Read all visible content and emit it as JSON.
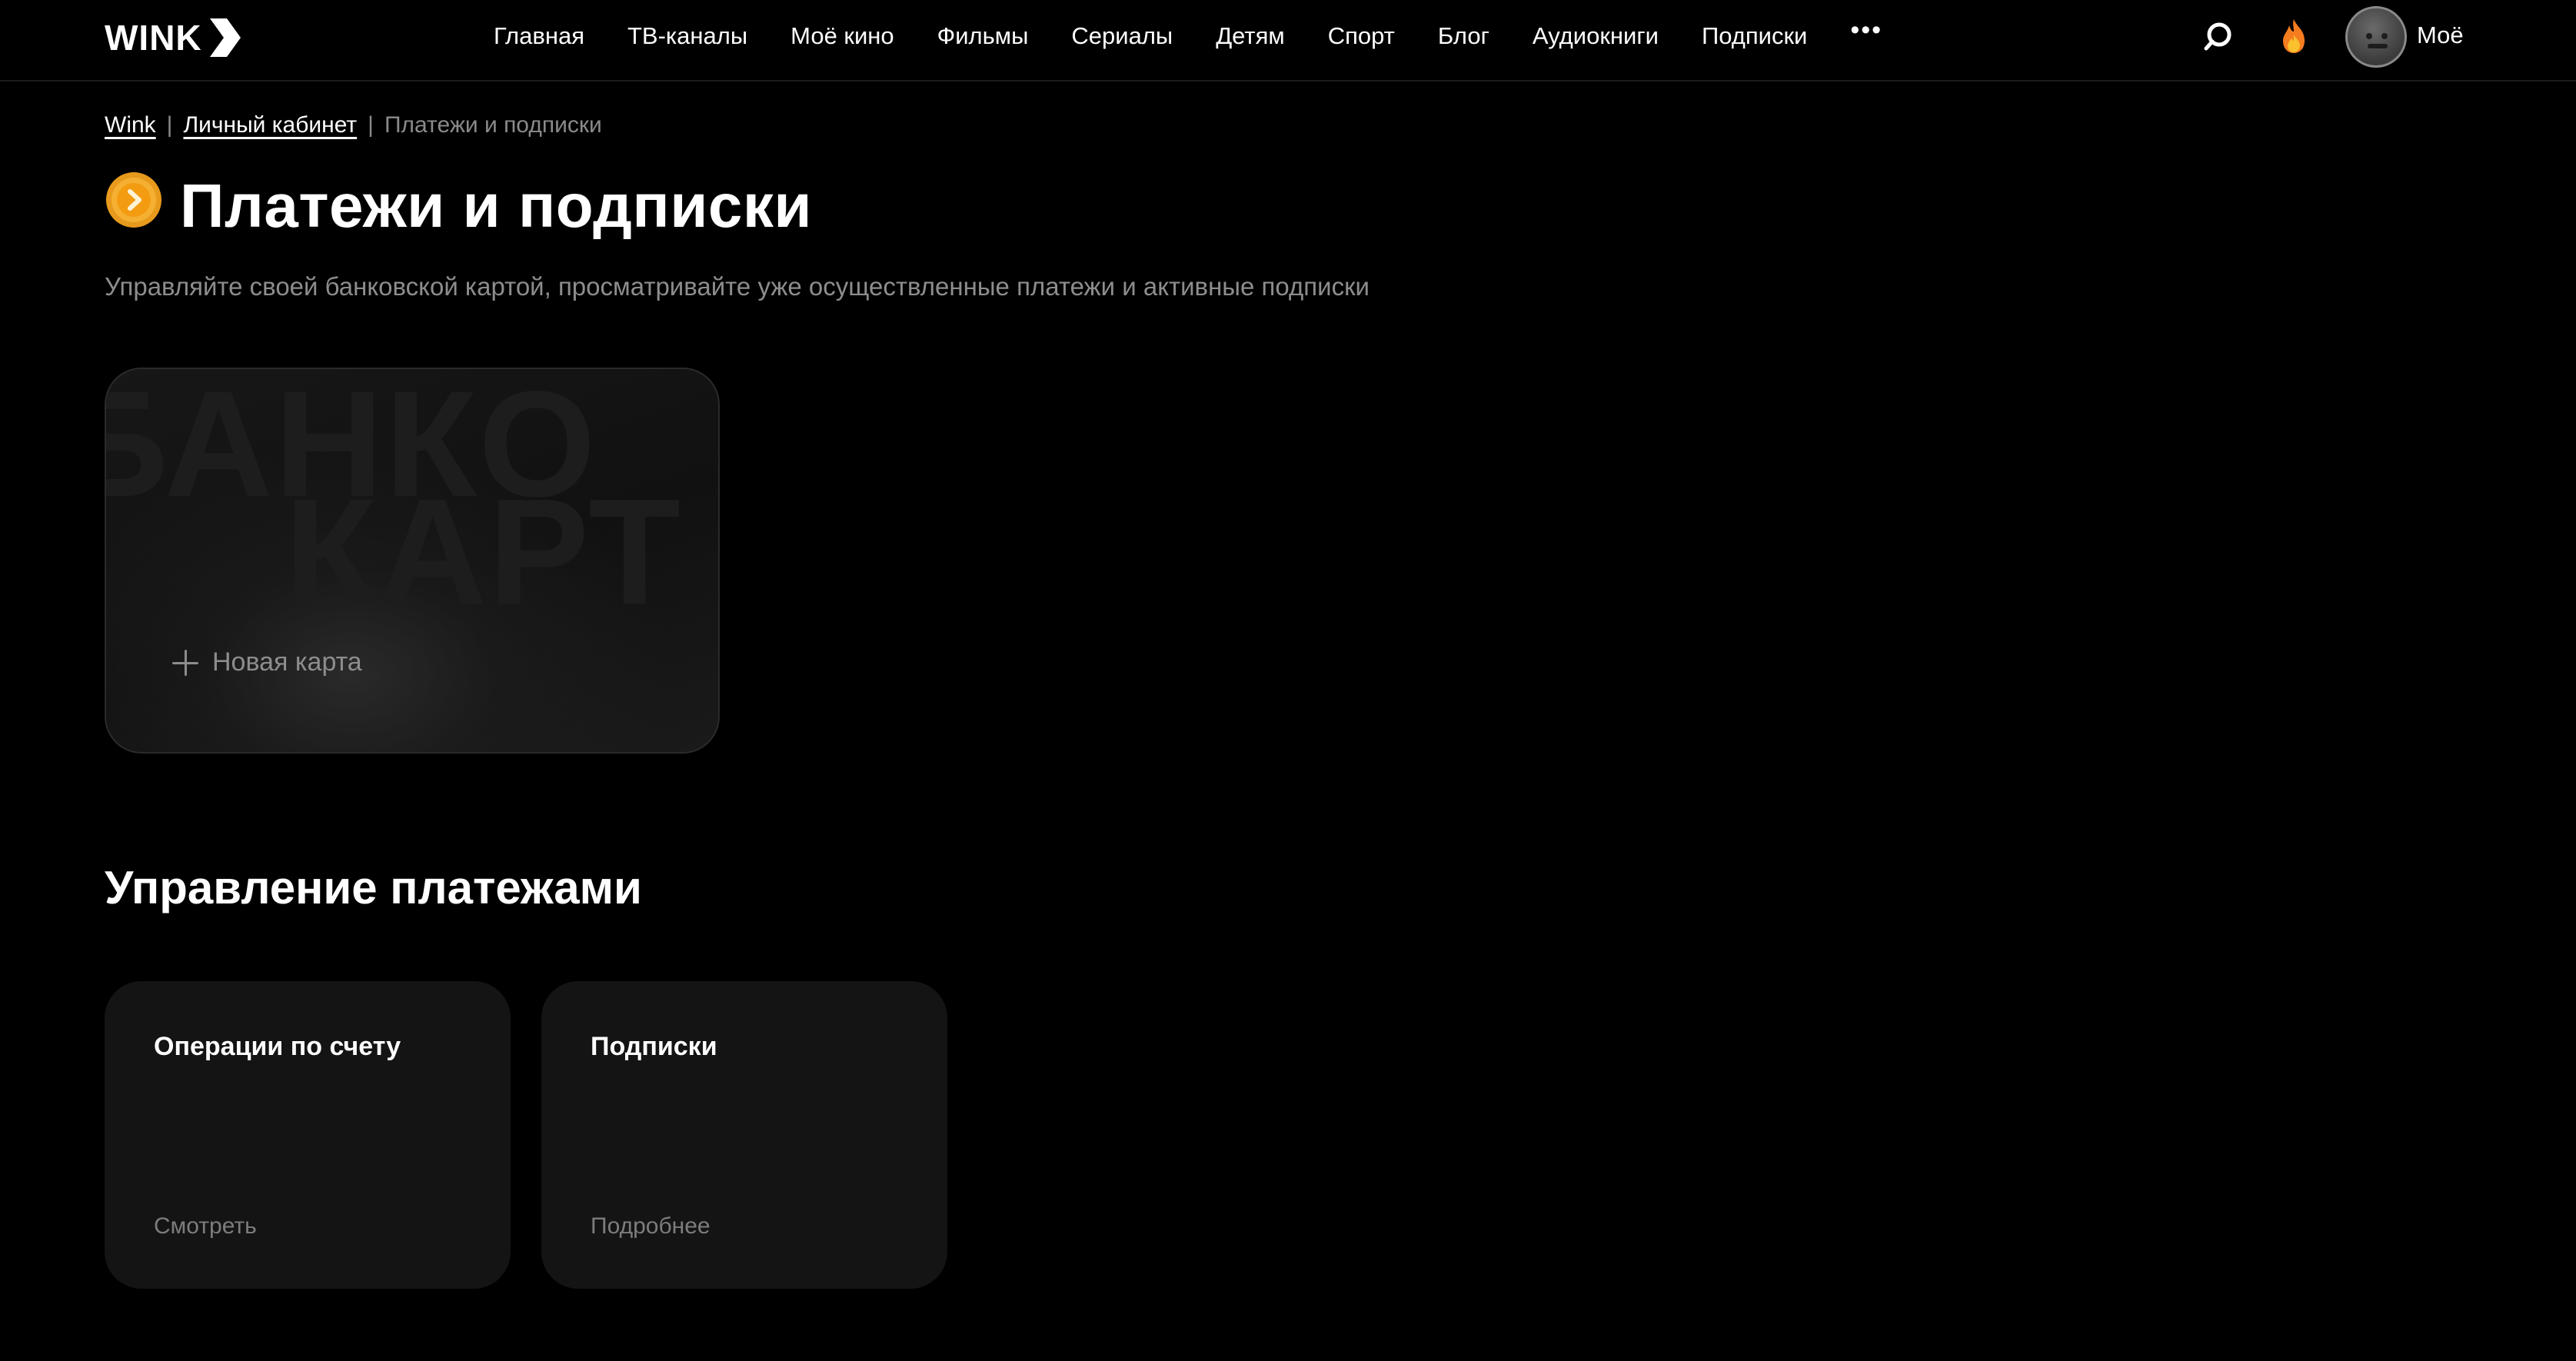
{
  "header": {
    "logo_text": "WINK",
    "nav": [
      {
        "label": "Главная"
      },
      {
        "label": "ТВ-каналы"
      },
      {
        "label": "Моё кино"
      },
      {
        "label": "Фильмы"
      },
      {
        "label": "Сериалы"
      },
      {
        "label": "Детям"
      },
      {
        "label": "Спорт"
      },
      {
        "label": "Блог"
      },
      {
        "label": "Аудиокниги"
      },
      {
        "label": "Подписки"
      }
    ],
    "more_label": "•••",
    "icons": [
      "search-icon",
      "fire-icon"
    ],
    "profile_label": "Моё"
  },
  "breadcrumb": {
    "items": [
      {
        "label": "Wink"
      },
      {
        "label": "Личный кабинет"
      },
      {
        "label": "Платежи и подписки"
      }
    ],
    "separator": "|"
  },
  "page": {
    "title": "Платежи и подписки",
    "subtitle": "Управляйте своей банковской картой, просматривайте уже осуществленные платежи и активные подписки"
  },
  "bank_card": {
    "watermark_line1": "БАНКО",
    "watermark_line2": "КАРТ",
    "new_card_label": "Новая карта"
  },
  "payments": {
    "section_title": "Управление платежами",
    "tiles": [
      {
        "title": "Операции по счету",
        "action": "Смотреть"
      },
      {
        "title": "Подписки",
        "action": "Подробнее"
      }
    ]
  },
  "colors": {
    "background": "#000000",
    "text_primary": "#ffffff",
    "text_muted": "#8d8d8d",
    "tile_bg": "#141414",
    "coin_orange": "#f5a524"
  }
}
